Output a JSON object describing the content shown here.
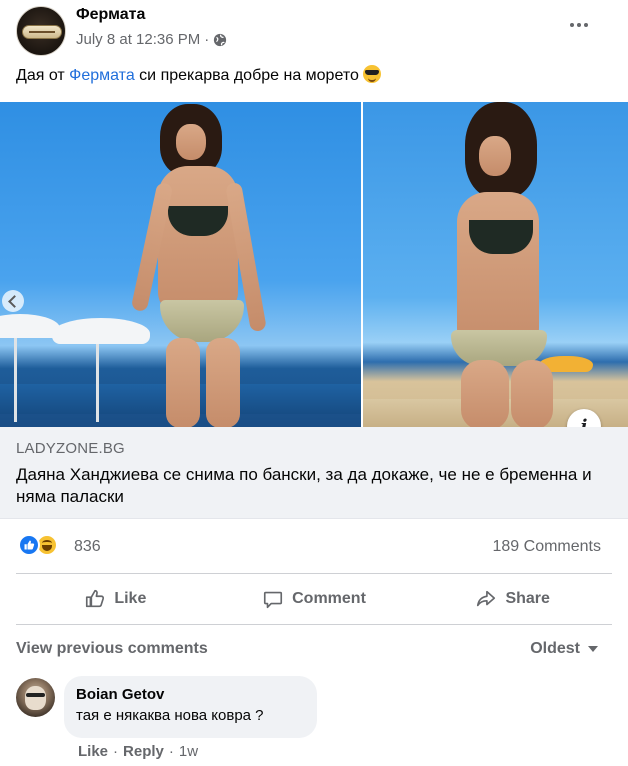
{
  "post": {
    "page_name": "Фермата",
    "timestamp": "July 8 at 12:36 PM",
    "separator": "·",
    "audience_icon": "globe-icon",
    "more_icon": "more-options-icon",
    "text_before_mention": "Дая от ",
    "mention": "Фермата",
    "text_after_mention": " си прекарва добре на морето ",
    "emoji": "smiling-face-with-sunglasses"
  },
  "link_preview": {
    "domain": "LADYZONE.BG",
    "title": "Даяна Ханджиева се снима по бански, за да докаже, че не е бременна и няма паласки"
  },
  "stats": {
    "reaction_icons": [
      "like-reaction-icon",
      "haha-reaction-icon"
    ],
    "reaction_count": "836",
    "comments_count": "189 Comments"
  },
  "actions": {
    "like_label": "Like",
    "comment_label": "Comment",
    "share_label": "Share"
  },
  "comments_section": {
    "view_previous": "View previous comments",
    "sort_label": "Oldest"
  },
  "comment": {
    "author": "Boian Getov",
    "text": "тая е някаква нова ковра ?",
    "like_label": "Like",
    "reply_label": "Reply",
    "separator": "·",
    "age": "1w"
  },
  "colors": {
    "link_blue": "#216fdb",
    "secondary_text": "#65676b",
    "like_blue": "#1877f2",
    "panel_gray": "#f0f2f5"
  }
}
